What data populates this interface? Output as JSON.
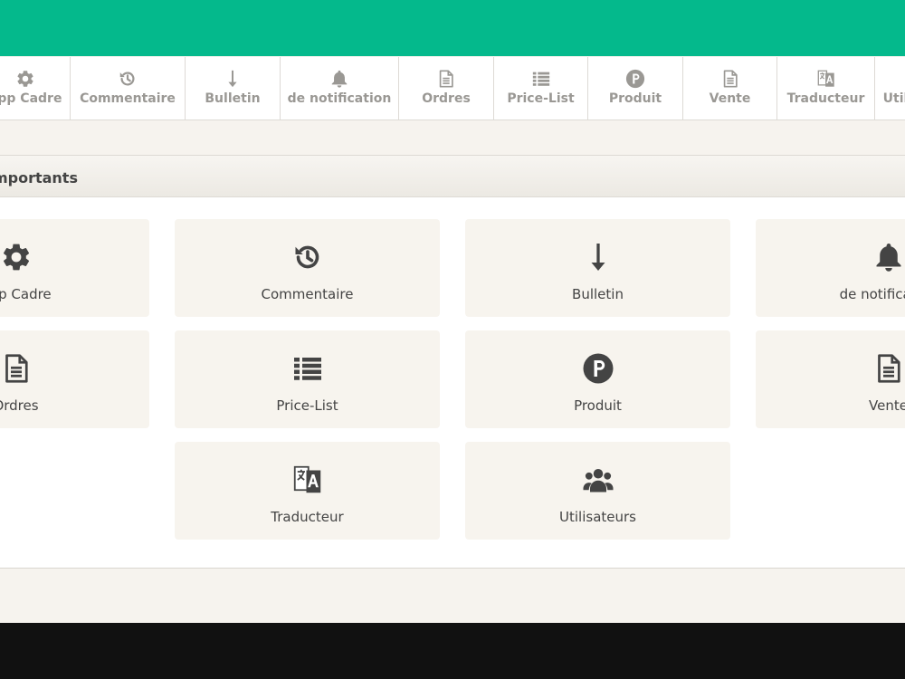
{
  "toolbar": {
    "items": [
      {
        "label": "App Cadre",
        "icon": "gear-icon"
      },
      {
        "label": "Commentaire",
        "icon": "history-icon"
      },
      {
        "label": "Bulletin",
        "icon": "arrow-down-icon"
      },
      {
        "label": "de notification",
        "icon": "bell-icon"
      },
      {
        "label": "Ordres",
        "icon": "document-icon"
      },
      {
        "label": "Price-List",
        "icon": "list-icon"
      },
      {
        "label": "Produit",
        "icon": "p-circle-icon"
      },
      {
        "label": "Vente",
        "icon": "document-icon"
      },
      {
        "label": "Traducteur",
        "icon": "translate-icon"
      },
      {
        "label": "Utilisateurs",
        "icon": "users-icon"
      }
    ]
  },
  "section": {
    "title": "Importants"
  },
  "tiles": [
    {
      "label": "App Cadre",
      "icon": "gear-icon"
    },
    {
      "label": "Commentaire",
      "icon": "history-icon"
    },
    {
      "label": "Bulletin",
      "icon": "arrow-down-icon"
    },
    {
      "label": "de notification",
      "icon": "bell-icon"
    },
    {
      "label": "Ordres",
      "icon": "document-icon"
    },
    {
      "label": "Price-List",
      "icon": "list-icon"
    },
    {
      "label": "Produit",
      "icon": "p-circle-icon"
    },
    {
      "label": "Vente",
      "icon": "document-icon"
    },
    {
      "label": "Traducteur",
      "icon": "translate-icon"
    },
    {
      "label": "Utilisateurs",
      "icon": "users-icon"
    }
  ],
  "colors": {
    "topbar": "#04b98c",
    "toolbar_text": "#9a9894",
    "tile_background": "#f7f4ee",
    "tile_text": "#444444"
  }
}
